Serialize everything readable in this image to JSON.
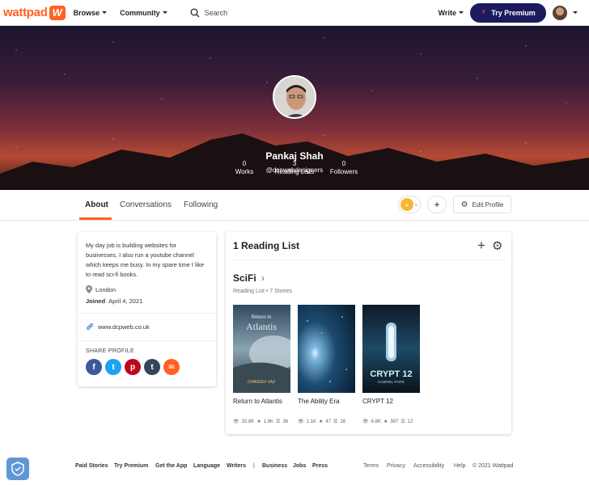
{
  "brand": {
    "name": "wattpad",
    "logo_glyph": "W",
    "color": "#ff6122"
  },
  "nav": {
    "browse": "Browse",
    "community": "Community",
    "search_placeholder": "Search",
    "write": "Write",
    "premium": "Try Premium"
  },
  "profile": {
    "name": "Pankaj Shah",
    "handle": "@dcpwebdesigners",
    "stats": [
      {
        "num": "0",
        "label": "Works"
      },
      {
        "num": "3",
        "label": "Reading Lists"
      },
      {
        "num": "0",
        "label": "Followers"
      }
    ]
  },
  "tabs": [
    "About",
    "Conversations",
    "Following"
  ],
  "actions": {
    "coin_caret": "-",
    "plus": "+",
    "edit": "Edit Profile"
  },
  "about": {
    "bio": "My day job is building websites for businesses, I also run a youtube channel which keeps me busy. In my spare time I like to read sci-fi books.",
    "location": "London",
    "joined_label": "Joined",
    "joined_date": "April 4, 2021",
    "website": "www.dcpweb.co.uk",
    "share_label": "SHARE PROFILE",
    "share_icons": [
      {
        "name": "facebook",
        "glyph": "f",
        "color": "#3b5998"
      },
      {
        "name": "twitter",
        "glyph": "t",
        "color": "#1da1f2"
      },
      {
        "name": "pinterest",
        "glyph": "p",
        "color": "#bd081c"
      },
      {
        "name": "tumblr",
        "glyph": "t",
        "color": "#35465c"
      },
      {
        "name": "email",
        "glyph": "✉",
        "color": "#ff6122"
      }
    ]
  },
  "reading_list": {
    "title": "1 Reading List",
    "list_name": "SciFi",
    "meta": "Reading List • 7 Stories",
    "books": [
      {
        "title": "Return to Atlantis",
        "cover_lines": [
          "Return to",
          "Atlantis",
          "CHAVEEV VAZ"
        ],
        "reads": "30.8K",
        "votes": "1.8K",
        "parts": "38"
      },
      {
        "title": "The Ability Era",
        "cover_lines": [],
        "reads": "1.1K",
        "votes": "47",
        "parts": "26"
      },
      {
        "title": "CRYPT 12",
        "cover_lines": [
          "CRYPT 12",
          "GABRIEL POPE"
        ],
        "reads": "6.8K",
        "votes": "387",
        "parts": "12"
      }
    ]
  },
  "footer": {
    "left": [
      "Paid Stories",
      "Try Premium",
      "Get the App",
      "Language",
      "Writers",
      "|",
      "Business",
      "Jobs",
      "Press"
    ],
    "right": [
      "Terms",
      "Privacy",
      "Accessibility",
      "Help",
      "© 2021 Wattpad"
    ]
  }
}
